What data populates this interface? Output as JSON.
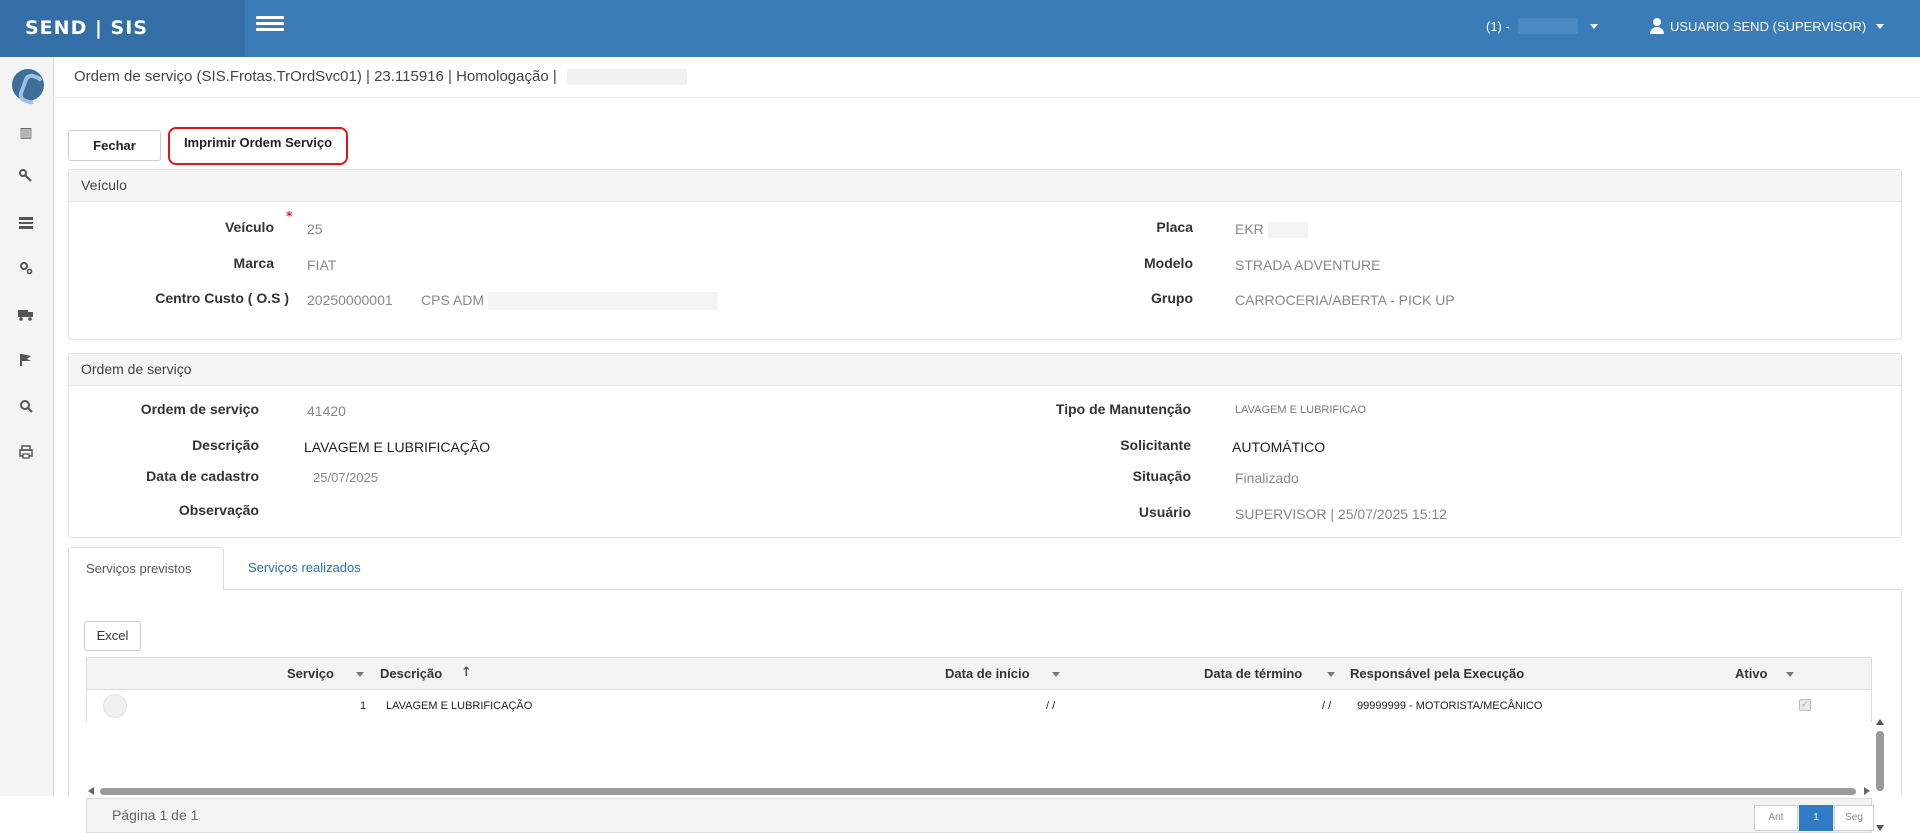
{
  "header": {
    "brand": "SEND | SIS",
    "company_label": "(1) -",
    "user_label": "USUARIO SEND (SUPERVISOR)"
  },
  "sidebar": {
    "items": [
      {
        "icon": "bar-chart-icon",
        "glyph": "▥"
      },
      {
        "icon": "wrench-icon",
        "glyph": "🔧"
      },
      {
        "icon": "list-icon",
        "glyph": "☰"
      },
      {
        "icon": "cogs-icon",
        "glyph": "⚙"
      },
      {
        "icon": "truck-icon",
        "glyph": "🚚"
      },
      {
        "icon": "flag-icon",
        "glyph": "⚑"
      },
      {
        "icon": "search-icon",
        "glyph": "🔍"
      },
      {
        "icon": "print-icon",
        "glyph": "🖶"
      }
    ]
  },
  "page": {
    "title": "Ordem de serviço (SIS.Frotas.TrOrdSvc01) | 23.115916 | Homologação |"
  },
  "toolbar": {
    "close_label": "Fechar",
    "print_label": "Imprimir Ordem Serviço"
  },
  "vehicle": {
    "section_title": "Veículo",
    "veiculo_label": "Veículo",
    "veiculo_value": "25",
    "marca_label": "Marca",
    "marca_value": "FIAT",
    "centro_label": "Centro Custo ( O.S )",
    "centro_code": "20250000001",
    "centro_name": "CPS ADM",
    "placa_label": "Placa",
    "placa_value": "EKR",
    "modelo_label": "Modelo",
    "modelo_value": "STRADA ADVENTURE",
    "grupo_label": "Grupo",
    "grupo_value": "CARROCERIA/ABERTA - PICK UP"
  },
  "order": {
    "section_title": "Ordem de serviço",
    "os_label": "Ordem de serviço",
    "os_value": "41420",
    "descricao_label": "Descrição",
    "descricao_value": "LAVAGEM E LUBRIFICAÇÃO",
    "data_label": "Data de cadastro",
    "data_value": "25/07/2025",
    "obs_label": "Observação",
    "tipo_label": "Tipo de Manutenção",
    "tipo_value": "LAVAGEM E LUBRIFICAO",
    "solicitante_label": "Solicitante",
    "solicitante_value": "AUTOMÁTICO",
    "situacao_label": "Situação",
    "situacao_value": "Finalizado",
    "usuario_label": "Usuário",
    "usuario_value": "SUPERVISOR | 25/07/2025 15:12"
  },
  "tabs": [
    {
      "label": "Serviços previstos",
      "active": true
    },
    {
      "label": "Serviços realizados",
      "active": false
    }
  ],
  "grid": {
    "excel_label": "Excel",
    "columns": [
      "Serviço",
      "Descrição",
      "Data de início",
      "Data de término",
      "Responsável pela Execução",
      "Ativo"
    ],
    "rows": [
      {
        "servico": "1",
        "descricao": "LAVAGEM E LUBRIFICAÇÃO",
        "inicio": "/ /",
        "termino": "/ /",
        "responsavel": "99999999 - MOTORISTA/MECÂNICO",
        "ativo": true
      }
    ],
    "pager_text": "Página 1 de 1",
    "prev_label": "Ant",
    "page_label": "1",
    "next_label": "Seg"
  },
  "colors": {
    "topbar": "#3a7cb8",
    "brand_bg": "#336ea6",
    "print_border": "#e0141a",
    "pager_active": "#2f7bc5"
  }
}
